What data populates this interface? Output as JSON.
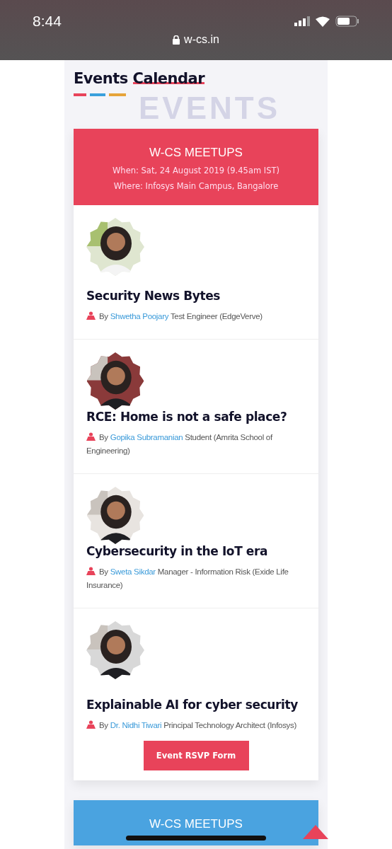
{
  "status_bar": {
    "time": "8:44",
    "url": "w-cs.in"
  },
  "section": {
    "title": "Events",
    "title_highlight": "Calendar",
    "background_word": "EVENTS"
  },
  "cards": [
    {
      "color": "#e8435a",
      "title": "W-CS MEETUPS",
      "when": "When: Sat, 24 August 2019 (9.45am IST)",
      "where": "Where: Infosys Main Campus, Bangalore",
      "talks": [
        {
          "title": "Security News Bytes",
          "by": "By",
          "speaker": "Shwetha Poojary",
          "role": "Test Engineer (EdgeVerve)"
        },
        {
          "title": "RCE: Home is not a safe place?",
          "by": "By",
          "speaker": "Gopika Subramanian",
          "role": "Student (Amrita School of Engineering)"
        },
        {
          "title": "Cybersecurity in the IoT era",
          "by": "By",
          "speaker": "Sweta Sikdar",
          "role": "Manager - Information Risk (Exide Life Insurance)"
        },
        {
          "title": "Explainable AI for cyber security",
          "by": "By",
          "speaker": "Dr. Nidhi Tiwari",
          "role": "Principal Technology Architect (Infosys)"
        }
      ],
      "button": "Event RSVP Form"
    },
    {
      "color": "#4aa3e0",
      "title": "W-CS MEETUPS"
    }
  ]
}
